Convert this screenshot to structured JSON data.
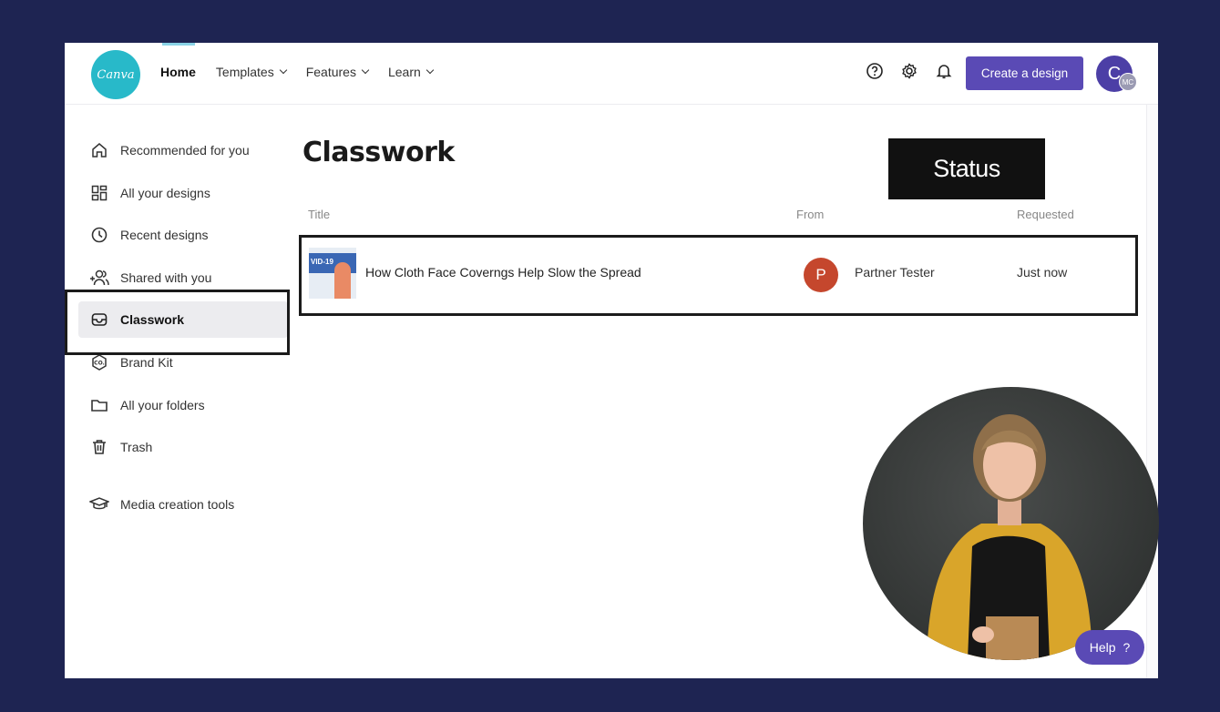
{
  "app": {
    "logo_text": "Canva"
  },
  "nav": {
    "items": [
      {
        "label": "Home",
        "has_menu": false
      },
      {
        "label": "Templates",
        "has_menu": true
      },
      {
        "label": "Features",
        "has_menu": true
      },
      {
        "label": "Learn",
        "has_menu": true
      }
    ],
    "icons": [
      "help-icon",
      "gear-icon",
      "bell-icon"
    ],
    "create_label": "Create a design",
    "avatar_initial": "C",
    "avatar_badge": "MC"
  },
  "sidebar": {
    "items": [
      {
        "label": "Recommended for you",
        "icon": "home-icon"
      },
      {
        "label": "All your designs",
        "icon": "grid-icon"
      },
      {
        "label": "Recent designs",
        "icon": "clock-icon"
      },
      {
        "label": "Shared with you",
        "icon": "users-add-icon"
      },
      {
        "label": "Classwork",
        "icon": "inbox-icon",
        "active": true
      },
      {
        "label": "Brand Kit",
        "icon": "brand-kit-icon"
      },
      {
        "label": "All your folders",
        "icon": "folder-icon"
      },
      {
        "label": "Trash",
        "icon": "trash-icon"
      },
      {
        "label": "Media creation tools",
        "icon": "graduation-cap-icon"
      }
    ]
  },
  "main": {
    "title": "Classwork",
    "columns": {
      "title": "Title",
      "from": "From",
      "requested": "Requested"
    },
    "rows": [
      {
        "thumb_text": "VID-19",
        "title": "How Cloth Face Coverngs Help Slow the Spread",
        "from_initial": "P",
        "from_name": "Partner Tester",
        "requested": "Just now"
      }
    ]
  },
  "overlay": {
    "status_label": "Status"
  },
  "help": {
    "label": "Help",
    "glyph": "?"
  },
  "colors": {
    "background": "#1e2452",
    "accent": "#5a4ab5",
    "logo": "#28b9c9",
    "from_avatar": "#c5472d"
  }
}
